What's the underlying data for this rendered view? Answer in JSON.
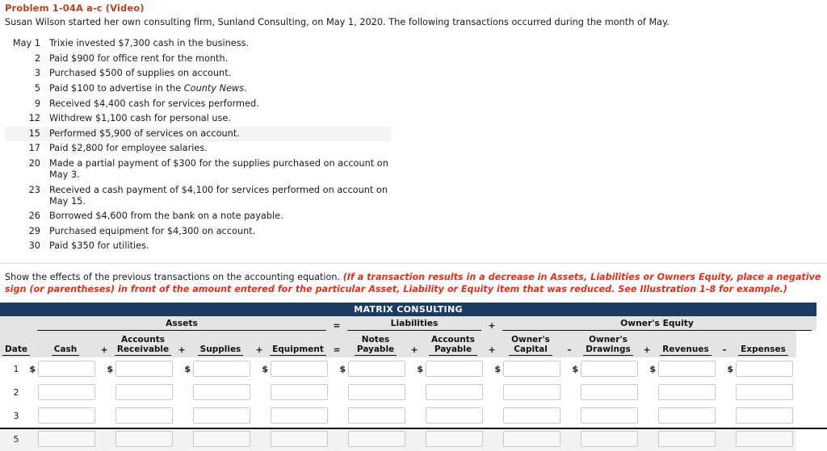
{
  "problem": {
    "title": "Problem 1-04A a-c (Video)",
    "intro": "Susan Wilson started her own consulting firm, Sunland Consulting, on May 1, 2020. The following transactions occurred during the month of May."
  },
  "transactions": [
    {
      "date": "May 1",
      "desc": "Trixie invested $7,300 cash in the business.",
      "shaded": false
    },
    {
      "date": "2",
      "desc": "Paid $900 for office rent for the month.",
      "shaded": false
    },
    {
      "date": "3",
      "desc": "Purchased $500 of supplies on account.",
      "shaded": false
    },
    {
      "date": "5",
      "desc_pre": "Paid $100 to advertise in the ",
      "desc_italic": "County News",
      "desc_post": ".",
      "shaded": false
    },
    {
      "date": "9",
      "desc": "Received $4,400 cash for services performed.",
      "shaded": false
    },
    {
      "date": "12",
      "desc": "Withdrew $1,100 cash for personal use.",
      "shaded": false
    },
    {
      "date": "15",
      "desc": "Performed $5,900 of services on account.",
      "shaded": true
    },
    {
      "date": "17",
      "desc": "Paid $2,800 for employee salaries.",
      "shaded": false
    },
    {
      "date": "20",
      "desc": "Made a partial payment of $300 for the supplies purchased on account on May 3.",
      "shaded": false
    },
    {
      "date": "23",
      "desc": "Received a cash payment of $4,100 for services performed on account on May 15.",
      "shaded": false
    },
    {
      "date": "26",
      "desc": "Borrowed $4,600 from the bank on a note payable.",
      "shaded": false
    },
    {
      "date": "29",
      "desc": "Purchased equipment for $4,300 on account.",
      "shaded": false
    },
    {
      "date": "30",
      "desc": "Paid $350 for utilities.",
      "shaded": false
    }
  ],
  "instruction": {
    "lead": "Show the effects of the previous transactions on the accounting equation. ",
    "emphasis": "(If a transaction results in a decrease in Assets, Liabilities or Owners Equity, place a negative sign (or parentheses) in front of the amount entered for the particular Asset, Liability or Equity item that was reduced. See Illustration 1-8 for example.)"
  },
  "matrix": {
    "company": "MATRIX CONSULTING",
    "groups": [
      {
        "label": "Assets",
        "op_after": "="
      },
      {
        "label": "Liabilities",
        "op_after": "+"
      },
      {
        "label": "Owner's Equity",
        "op_after": ""
      }
    ],
    "date_header": "Date",
    "columns": [
      {
        "label": "Cash",
        "op_after": "+"
      },
      {
        "label": "Accounts\nReceivable",
        "op_after": "+"
      },
      {
        "label": "Supplies",
        "op_after": "+"
      },
      {
        "label": "Equipment",
        "op_after": "="
      },
      {
        "label": "Notes\nPayable",
        "op_after": "+"
      },
      {
        "label": "Accounts\nPayable",
        "op_after": "+"
      },
      {
        "label": "Owner's\nCapital",
        "op_after": "–"
      },
      {
        "label": "Owner's\nDrawings",
        "op_after": "+"
      },
      {
        "label": "Revenues",
        "op_after": "–"
      },
      {
        "label": "Expenses",
        "op_after": ""
      }
    ],
    "rows": [
      {
        "num": "1",
        "show_dollar": true,
        "shaded": false,
        "values": [
          "",
          "",
          "",
          "",
          "",
          "",
          "",
          "",
          "",
          ""
        ]
      },
      {
        "num": "2",
        "show_dollar": false,
        "shaded": false,
        "values": [
          "",
          "",
          "",
          "",
          "",
          "",
          "",
          "",
          "",
          ""
        ]
      },
      {
        "num": "3",
        "show_dollar": false,
        "shaded": false,
        "values": [
          "",
          "",
          "",
          "",
          "",
          "",
          "",
          "",
          "",
          ""
        ]
      },
      {
        "num": "5",
        "show_dollar": false,
        "shaded": true,
        "values": [
          "",
          "",
          "",
          "",
          "",
          "",
          "",
          "",
          "",
          ""
        ]
      }
    ],
    "colors": {
      "header_bar": "#1c3b63",
      "header_bg": "#e4e4e4",
      "accent_red": "#e0301e",
      "title_orange": "#b4441f"
    }
  }
}
